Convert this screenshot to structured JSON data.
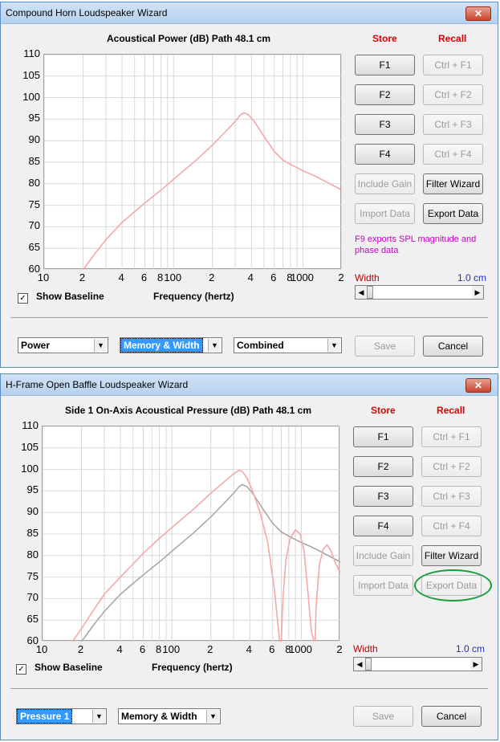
{
  "windows": [
    {
      "title": "Compound Horn Loudspeaker Wizard",
      "close_label": "✕",
      "chart_title": "Acoustical Power (dB)   Path 48.1 cm",
      "store_label": "Store",
      "recall_label": "Recall",
      "store_buttons": [
        "F1",
        "F2",
        "F3",
        "F4"
      ],
      "recall_buttons": [
        "Ctrl + F1",
        "Ctrl + F2",
        "Ctrl + F3",
        "Ctrl + F4"
      ],
      "include_gain_label": "Include Gain",
      "filter_wizard_label": "Filter Wizard",
      "import_data_label": "Import Data",
      "export_data_label": "Export Data",
      "export_enabled": true,
      "note": "F9 exports SPL magnitude and phase data",
      "width_label": "Width",
      "width_value": "1.0 cm",
      "show_baseline_label": "Show Baseline",
      "show_baseline_checked": "✓",
      "xlabel": "Frequency (hertz)",
      "select1": "Power",
      "select2": "Memory & Width",
      "select3": "Combined",
      "save_label": "Save",
      "cancel_label": "Cancel",
      "chart_data": {
        "type": "line",
        "title": "Acoustical Power (dB)   Path 48.1 cm",
        "xlabel": "Frequency (hertz)",
        "ylabel": "",
        "x_scale": "log",
        "xlim": [
          10,
          2000
        ],
        "ylim": [
          60,
          110
        ],
        "yticks": [
          110,
          105,
          100,
          95,
          90,
          85,
          80,
          75,
          70,
          65,
          60
        ],
        "xtick_labels": [
          "10",
          "2",
          "4",
          "6",
          "8",
          "100",
          "2",
          "4",
          "6",
          "8",
          "1000",
          "2"
        ],
        "grid": true,
        "series": [
          {
            "color": "#f4a8a8",
            "x": [
              20,
              25,
              30,
              40,
              50,
              60,
              80,
              100,
              150,
              200,
              250,
              300,
              330,
              350,
              380,
              420,
              500,
              600,
              700,
              800,
              1000,
              1200,
              1500,
              2000
            ],
            "y": [
              60,
              64,
              67,
              71,
              73.5,
              75.5,
              78.5,
              81,
              85.5,
              89,
              92,
              94.5,
              96,
              96.5,
              96,
              94.5,
              91,
              87.5,
              85.5,
              84.5,
              83,
              82,
              80.5,
              78.5
            ]
          }
        ]
      }
    },
    {
      "title": "H-Frame Open Baffle Loudspeaker Wizard",
      "close_label": "✕",
      "chart_title": "Side 1 On-Axis Acoustical Pressure (dB)   Path 48.1 cm",
      "store_label": "Store",
      "recall_label": "Recall",
      "store_buttons": [
        "F1",
        "F2",
        "F3",
        "F4"
      ],
      "recall_buttons": [
        "Ctrl + F1",
        "Ctrl + F2",
        "Ctrl + F3",
        "Ctrl + F4"
      ],
      "include_gain_label": "Include Gain",
      "filter_wizard_label": "Filter Wizard",
      "import_data_label": "Import Data",
      "export_data_label": "Export Data",
      "export_enabled": false,
      "note": "",
      "width_label": "Width",
      "width_value": "1.0 cm",
      "show_baseline_label": "Show Baseline",
      "show_baseline_checked": "✓",
      "xlabel": "Frequency (hertz)",
      "select1": "Pressure 1",
      "select2": "Memory & Width",
      "save_label": "Save",
      "cancel_label": "Cancel",
      "chart_data": {
        "type": "line",
        "title": "Side 1 On-Axis Acoustical Pressure (dB)   Path 48.1 cm",
        "xlabel": "Frequency (hertz)",
        "ylabel": "",
        "x_scale": "log",
        "xlim": [
          10,
          2000
        ],
        "ylim": [
          60,
          110
        ],
        "yticks": [
          110,
          105,
          100,
          95,
          90,
          85,
          80,
          75,
          70,
          65,
          60
        ],
        "xtick_labels": [
          "10",
          "2",
          "4",
          "6",
          "8",
          "100",
          "2",
          "4",
          "6",
          "8",
          "1000",
          "2"
        ],
        "grid": true,
        "series": [
          {
            "color": "#f4a8a8",
            "x": [
              17,
              20,
              25,
              30,
              40,
              50,
              60,
              80,
              100,
              150,
              200,
              250,
              300,
              330,
              350,
              380,
              420,
              480,
              550,
              620,
              680,
              700,
              720,
              760,
              820,
              900,
              980,
              1050,
              1120,
              1200,
              1260,
              1280,
              1300,
              1380,
              1480,
              1580,
              1700,
              1850,
              2000
            ],
            "y": [
              60,
              63,
              67.5,
              71,
              75,
              78,
              80.5,
              84,
              86.5,
              91,
              94.5,
              97,
              99,
              99.8,
              99.5,
              98,
              95,
              90,
              83,
              72,
              60,
              60,
              70,
              79,
              84,
              86,
              85,
              81,
              72,
              62,
              60,
              60,
              68,
              78,
              81.5,
              82.5,
              81,
              78,
              76
            ]
          },
          {
            "color": "#a8a8a8",
            "x": [
              20,
              25,
              30,
              40,
              50,
              60,
              80,
              100,
              150,
              200,
              250,
              300,
              330,
              350,
              380,
              420,
              500,
              600,
              700,
              800,
              1000,
              1200,
              1500,
              2000
            ],
            "y": [
              60,
              64,
              67,
              71,
              73.5,
              75.5,
              78.5,
              81,
              85.5,
              89,
              92,
              94.5,
              96,
              96.5,
              96,
              94.5,
              91,
              87.5,
              85.5,
              84.5,
              83,
              82,
              80.5,
              78.5
            ]
          }
        ]
      }
    }
  ]
}
